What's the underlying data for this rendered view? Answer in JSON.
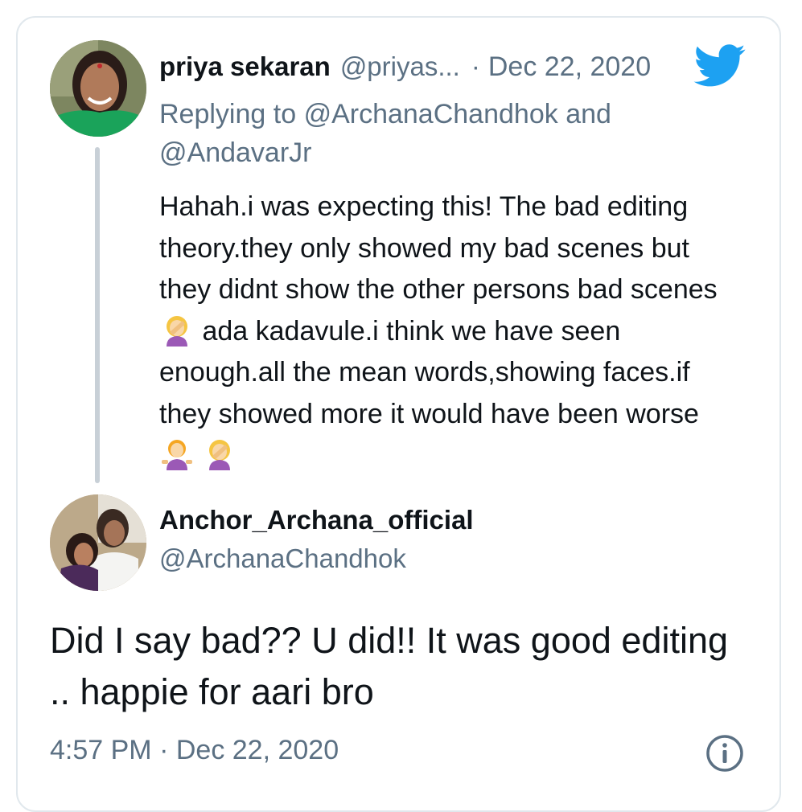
{
  "reply_tweet": {
    "author_name": "priya sekaran",
    "handle": "@priyas...",
    "separator": "·",
    "date": "Dec 22, 2020",
    "replying_prefix": "Replying to",
    "replying_to_1": "@ArchanaChandhok",
    "replying_and": "and",
    "replying_to_2": "@AndavarJr",
    "text_part1": "Hahah.i was expecting this! The bad editing theory.they only showed my bad scenes but they didnt show the other persons bad scenes",
    "text_part2": "ada kadavule.i think we have seen enough.all the mean words,showing faces.if they showed more it would have been worse",
    "emoji_1": "facepalm-woman",
    "emoji_2": "shrug-woman",
    "emoji_3": "facepalm-woman"
  },
  "main_tweet": {
    "author_name": "Anchor_Archana_official",
    "handle": "@ArchanaChandhok",
    "text": "Did I say bad?? U did!! It was good editing .. happie for aari bro",
    "time": "4:57 PM",
    "separator": "·",
    "date": "Dec 22, 2020"
  },
  "colors": {
    "twitter_blue": "#1da1f2",
    "secondary_text": "#5b7083",
    "primary_text": "#0f1419",
    "border": "#e1e8ed"
  },
  "icons": {
    "brand": "twitter-bird-icon",
    "info": "info-icon"
  }
}
